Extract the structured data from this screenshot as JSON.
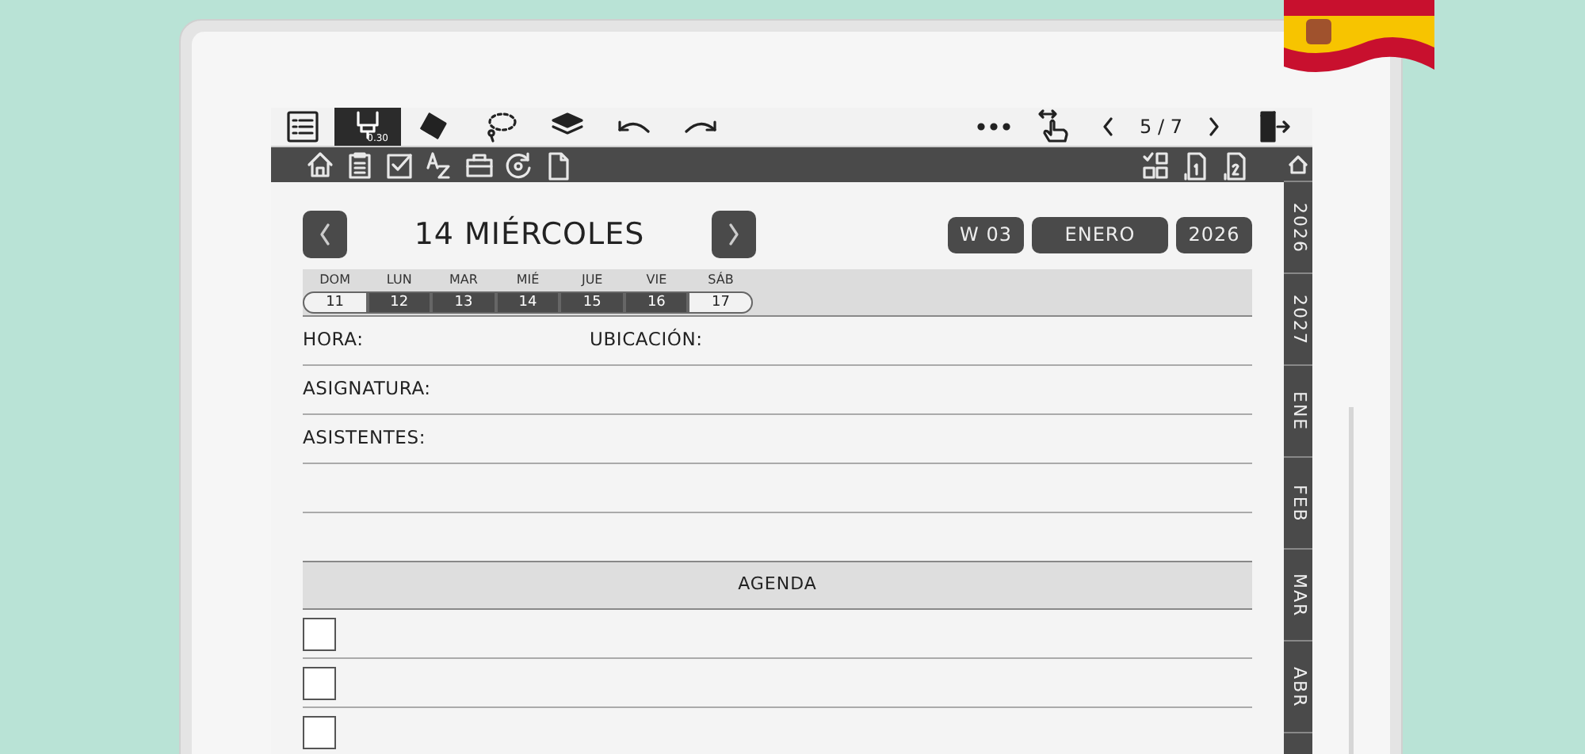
{
  "toolbar": {
    "tools": [
      {
        "kind": "pen",
        "selected": true,
        "label": "0.30"
      },
      {
        "kind": "eraser",
        "selected": false
      },
      {
        "kind": "lasso",
        "selected": false
      },
      {
        "kind": "layers",
        "selected": false
      }
    ],
    "page": "5 / 7"
  },
  "side_tabs": [
    "2026",
    "2027",
    "ENE",
    "FEB",
    "MAR",
    "ABR"
  ],
  "header": {
    "title": "14 MIÉRCOLES",
    "week": "W 03",
    "month": "ENERO",
    "year": "2026"
  },
  "days": [
    {
      "name": "DOM",
      "number": "11",
      "shaded": false
    },
    {
      "name": "LUN",
      "number": "12",
      "shaded": true
    },
    {
      "name": "MAR",
      "number": "13",
      "shaded": true
    },
    {
      "name": "MIÉ",
      "number": "14",
      "shaded": true
    },
    {
      "name": "JUE",
      "number": "15",
      "shaded": true
    },
    {
      "name": "VIE",
      "number": "16",
      "shaded": true
    },
    {
      "name": "SÁB",
      "number": "17",
      "shaded": false
    }
  ],
  "fields": [
    {
      "labels": [
        "HORA:",
        "UBICACIÓN:"
      ]
    },
    {
      "labels": [
        "ASIGNATURA:"
      ]
    },
    {
      "labels": [
        "ASISTENTES:"
      ]
    }
  ],
  "agenda": {
    "title": "AGENDA",
    "items": [
      {
        "checked": false
      },
      {
        "checked": false
      },
      {
        "checked": false
      }
    ]
  }
}
